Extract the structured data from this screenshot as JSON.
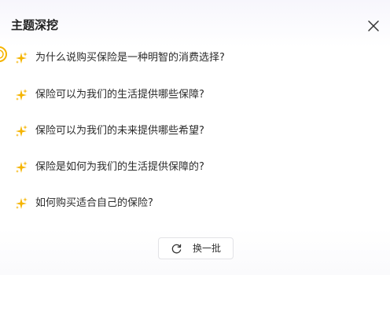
{
  "header": {
    "title": "主题深挖",
    "close_icon": "close-icon"
  },
  "questions": [
    {
      "label": "为什么说购买保险是一种明智的消费选择?",
      "icon": "sparkles-icon"
    },
    {
      "label": "保险可以为我们的生活提供哪些保障?",
      "icon": "sparkles-icon"
    },
    {
      "label": "保险可以为我们的未来提供哪些希望?",
      "icon": "sparkles-icon"
    },
    {
      "label": "保险是如何为我们的生活提供保障的?",
      "icon": "sparkles-icon"
    },
    {
      "label": "如何购买适合自己的保险?",
      "icon": "sparkles-icon"
    }
  ],
  "footer": {
    "refresh_label": "换一批",
    "refresh_icon": "refresh-icon"
  },
  "colors": {
    "sparkle": "#f5b400",
    "text": "#2b2b2b",
    "title": "#1f1f1f"
  }
}
